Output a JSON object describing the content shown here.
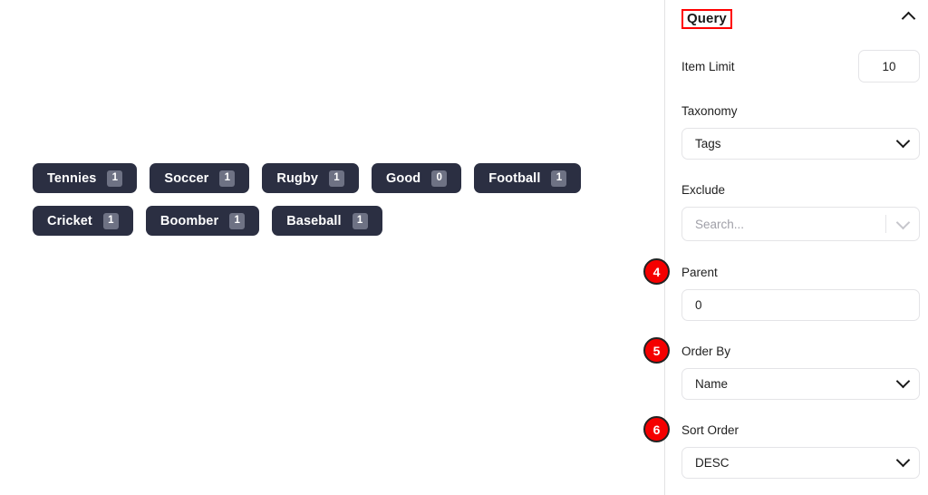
{
  "preview": {
    "tags": [
      {
        "label": "Tennies",
        "count": "1"
      },
      {
        "label": "Soccer",
        "count": "1"
      },
      {
        "label": "Rugby",
        "count": "1"
      },
      {
        "label": "Good",
        "count": "0"
      },
      {
        "label": "Football",
        "count": "1"
      },
      {
        "label": "Cricket",
        "count": "1"
      },
      {
        "label": "Boomber",
        "count": "1"
      },
      {
        "label": "Baseball",
        "count": "1"
      }
    ]
  },
  "sidebar": {
    "panel": {
      "title": "Query",
      "collapse_icon": "chevron-up-icon",
      "highlight_color": "#ff0000"
    },
    "fields": {
      "item_limit": {
        "label": "Item Limit",
        "value": "10"
      },
      "taxonomy": {
        "label": "Taxonomy",
        "value": "Tags",
        "icon": "chevron-down-icon"
      },
      "exclude": {
        "label": "Exclude",
        "placeholder": "Search...",
        "icon": "chevron-down-icon"
      },
      "parent": {
        "label": "Parent",
        "value": "0"
      },
      "order_by": {
        "label": "Order By",
        "value": "Name",
        "icon": "chevron-down-icon"
      },
      "sort_order": {
        "label": "Sort Order",
        "value": "DESC",
        "icon": "chevron-down-icon"
      }
    }
  },
  "annotations": {
    "markers": [
      {
        "number": "4",
        "target": "parent"
      },
      {
        "number": "5",
        "target": "order-by"
      },
      {
        "number": "6",
        "target": "sort-order"
      }
    ],
    "marker_color": "#f50000"
  }
}
